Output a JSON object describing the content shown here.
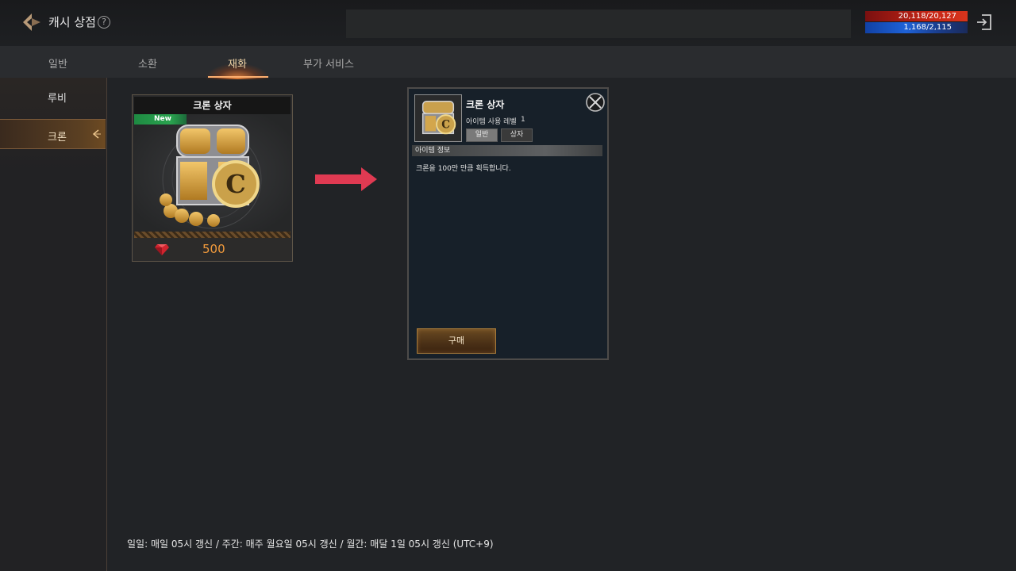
{
  "header": {
    "title": "캐시 상점",
    "help_icon": "question-circle-icon",
    "hp": "20,118/20,127",
    "mp": "1,168/2,115",
    "hp_color": "#c22414",
    "mp_color": "#1e62d8"
  },
  "tabs": [
    {
      "label": "일반",
      "active": false
    },
    {
      "label": "소환",
      "active": false
    },
    {
      "label": "재화",
      "active": true
    },
    {
      "label": "부가 서비스",
      "active": false
    }
  ],
  "sidebar": {
    "items": [
      {
        "label": "루비",
        "active": false
      },
      {
        "label": "크론",
        "active": true
      }
    ]
  },
  "product": {
    "title": "크론 상자",
    "badge": "New",
    "price": "500",
    "currency_icon": "ruby-icon",
    "price_color": "#f19a3c"
  },
  "detail": {
    "title": "크론 상자",
    "level_label": "아이템 사용 레벨",
    "level_value": "1",
    "chips": [
      "일반",
      "상자"
    ],
    "info_header": "아이템 정보",
    "info_text": "크론을 100만 만큼 획득합니다.",
    "buy_label": "구매"
  },
  "footer": {
    "note": "일일: 매일 05시 갱신 / 주간: 매주 월요일 05시 갱신 / 월간: 매달 1일 05시 갱신 (UTC+9)"
  }
}
